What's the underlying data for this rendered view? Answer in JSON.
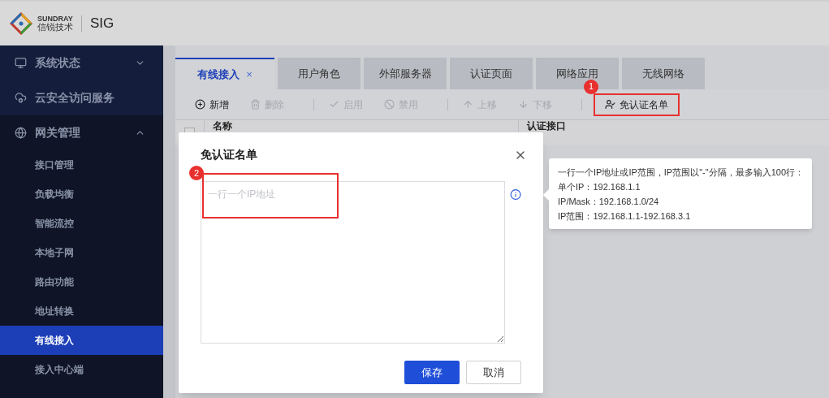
{
  "header": {
    "brand_top": "SUNDRAY",
    "brand_bottom": "信锐技术",
    "product": "SIG"
  },
  "sidebar": {
    "items": [
      {
        "label": "系统状态",
        "expanded": false,
        "has_toggle": true
      },
      {
        "label": "云安全访问服务",
        "expanded": false,
        "has_toggle": false
      },
      {
        "label": "网关管理",
        "expanded": true,
        "has_toggle": true,
        "children": [
          {
            "label": "接口管理",
            "selected": false
          },
          {
            "label": "负载均衡",
            "selected": false
          },
          {
            "label": "智能流控",
            "selected": false
          },
          {
            "label": "本地子网",
            "selected": false
          },
          {
            "label": "路由功能",
            "selected": false
          },
          {
            "label": "地址转换",
            "selected": false
          },
          {
            "label": "有线接入",
            "selected": true
          },
          {
            "label": "接入中心端",
            "selected": false
          }
        ]
      }
    ]
  },
  "tabs": [
    {
      "label": "有线接入",
      "selected": true,
      "closable": true,
      "close": "×"
    },
    {
      "label": "用户角色",
      "selected": false,
      "closable": false
    },
    {
      "label": "外部服务器",
      "selected": false,
      "closable": false
    },
    {
      "label": "认证页面",
      "selected": false,
      "closable": false
    },
    {
      "label": "网络应用",
      "selected": false,
      "closable": false
    },
    {
      "label": "无线网络",
      "selected": false,
      "closable": false
    }
  ],
  "toolbar": {
    "groups": [
      {
        "buttons": [
          {
            "label": "新增",
            "disabled": false
          },
          {
            "label": "删除",
            "disabled": true
          }
        ]
      },
      {
        "buttons": [
          {
            "label": "启用",
            "disabled": true
          },
          {
            "label": "禁用",
            "disabled": true
          }
        ]
      },
      {
        "buttons": [
          {
            "label": "上移",
            "disabled": true
          },
          {
            "label": "下移",
            "disabled": true
          }
        ]
      },
      {
        "buttons": [
          {
            "label": "免认证名单",
            "disabled": false,
            "callout": "1"
          }
        ]
      }
    ]
  },
  "table": {
    "columns": [
      "名称",
      "认证接口"
    ],
    "select_all": {
      "checked": false
    }
  },
  "dialog": {
    "title": "免认证名单",
    "placeholder": "一行一个IP地址",
    "callout": "2",
    "buttons": [
      {
        "label": "保存",
        "kind": "primary"
      },
      {
        "label": "取消",
        "kind": "default"
      }
    ]
  },
  "tooltip": {
    "lines": [
      "一行一个IP地址或IP范围，IP范围以\"-\"分隔，最多输入100行：",
      "单个IP：192.168.1.1",
      "IP/Mask：192.168.1.0/24",
      "IP范围：192.168.1.1-192.168.3.1"
    ]
  }
}
